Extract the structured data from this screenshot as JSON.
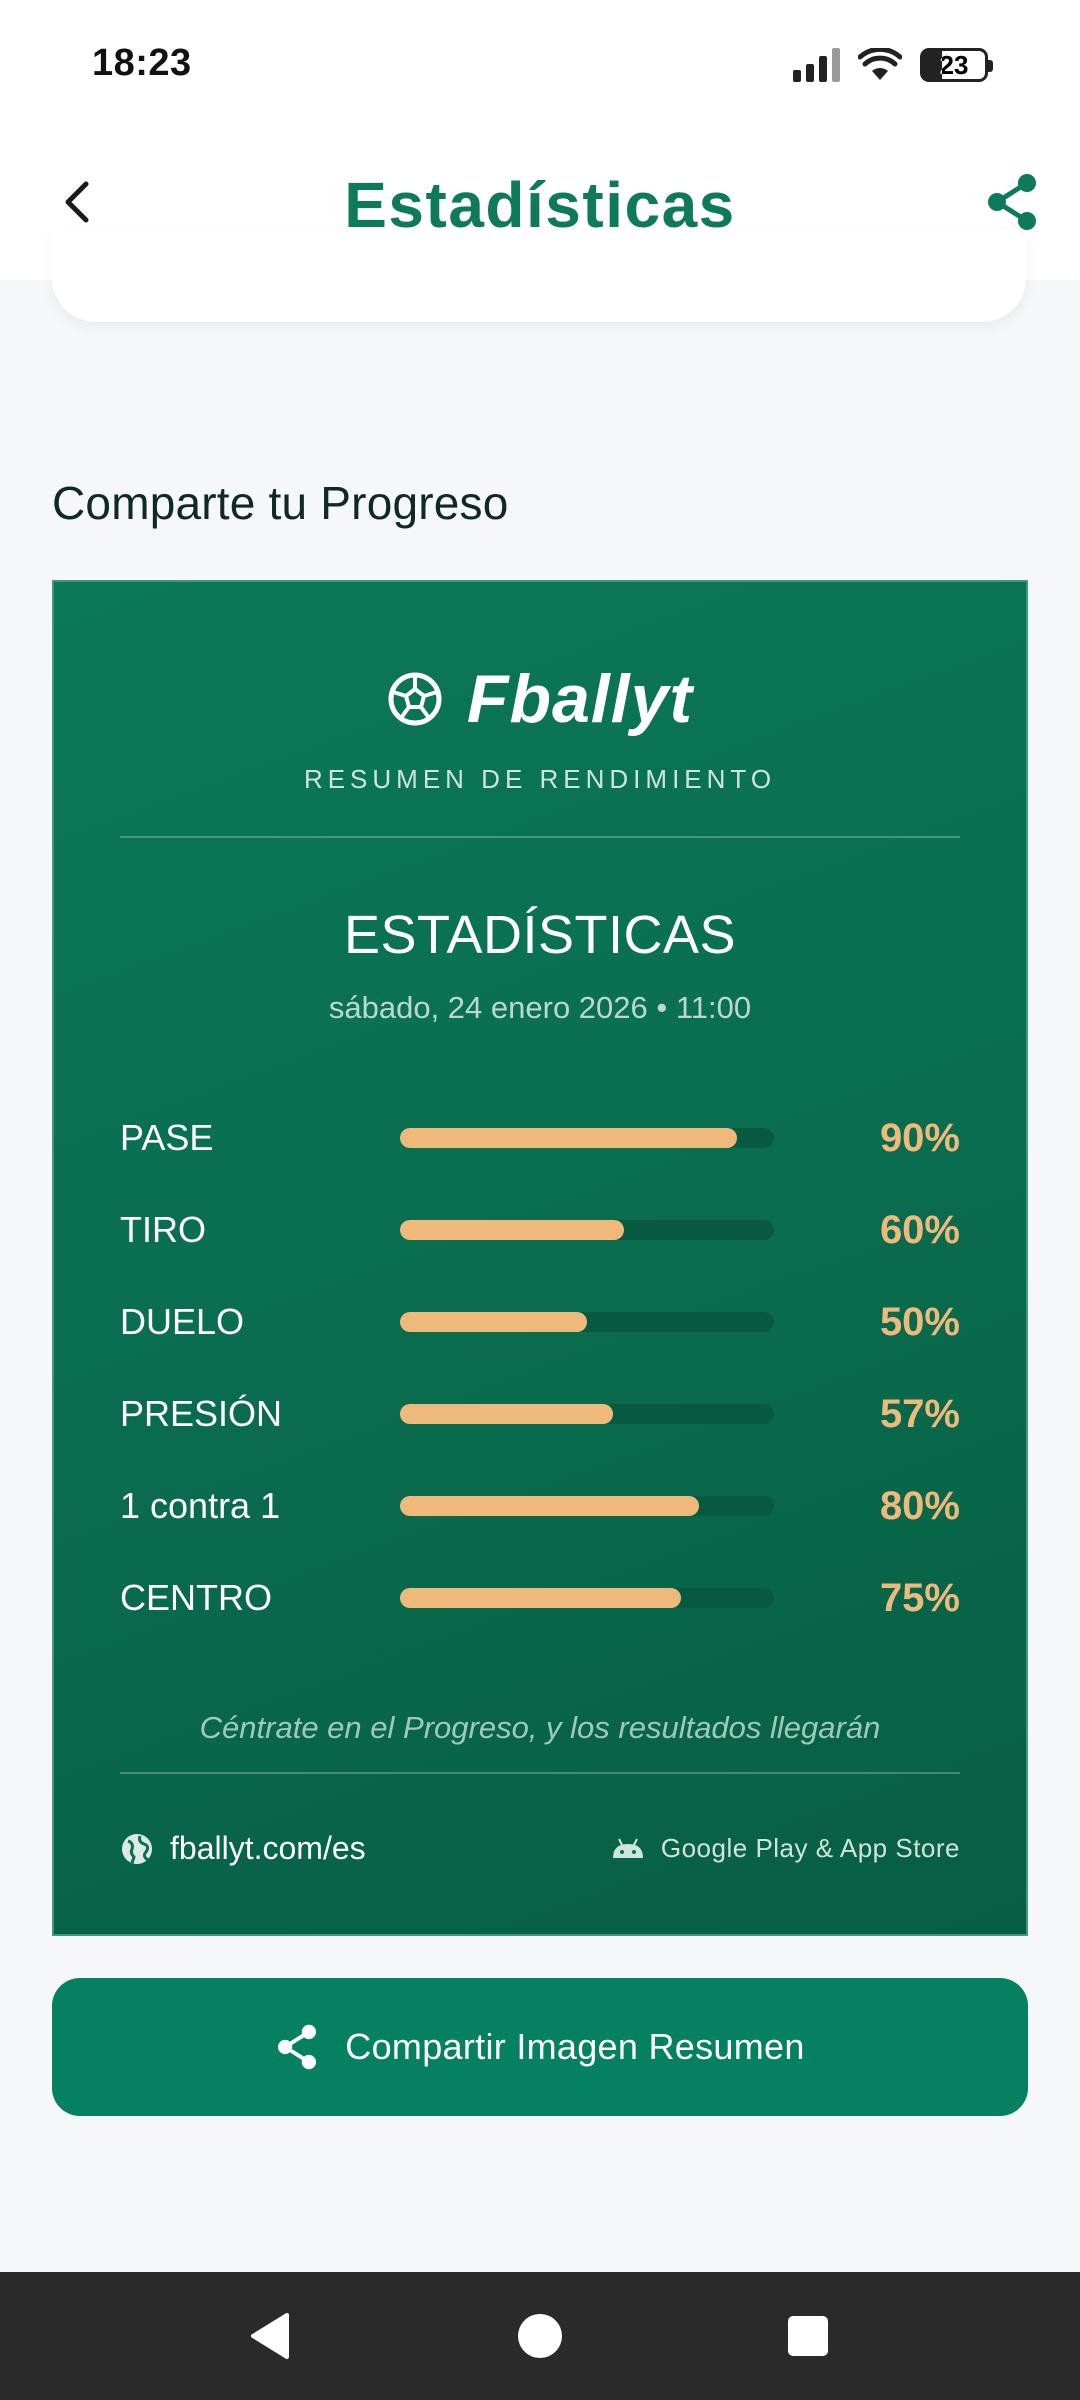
{
  "status_bar": {
    "time": "18:23",
    "battery_level": "23",
    "icons": [
      "signal-icon",
      "wifi-icon",
      "battery-icon"
    ]
  },
  "header": {
    "title": "Estadísticas",
    "back_icon": "chevron-left-icon",
    "share_icon": "share-icon"
  },
  "section": {
    "title": "Comparte tu Progreso"
  },
  "card": {
    "brand": "Fballyt",
    "subtitle": "RESUMEN DE RENDIMIENTO",
    "heading": "ESTADÍSTICAS",
    "date": "sábado, 24 enero 2026 • 11:00",
    "stats": [
      {
        "label": "PASE",
        "value": "90%",
        "fraction": 0.9
      },
      {
        "label": "TIRO",
        "value": "60%",
        "fraction": 0.6
      },
      {
        "label": "DUELO",
        "value": "50%",
        "fraction": 0.5
      },
      {
        "label": "PRESIÓN",
        "value": "57%",
        "fraction": 0.57
      },
      {
        "label": "1 contra 1",
        "value": "80%",
        "fraction": 0.8
      },
      {
        "label": "CENTRO",
        "value": "75%",
        "fraction": 0.75
      }
    ],
    "quote": "Céntrate en el Progreso, y los resultados llegarán",
    "website": "fballyt.com/es",
    "stores": "Google Play & App Store"
  },
  "share_button": {
    "label": "Compartir Imagen Resumen"
  },
  "colors": {
    "accent": "#0e7a5a",
    "card_bg": "#0a6e50",
    "bar_fill": "#f0b97c",
    "bar_track": "#075a40",
    "button_bg": "#058060"
  }
}
